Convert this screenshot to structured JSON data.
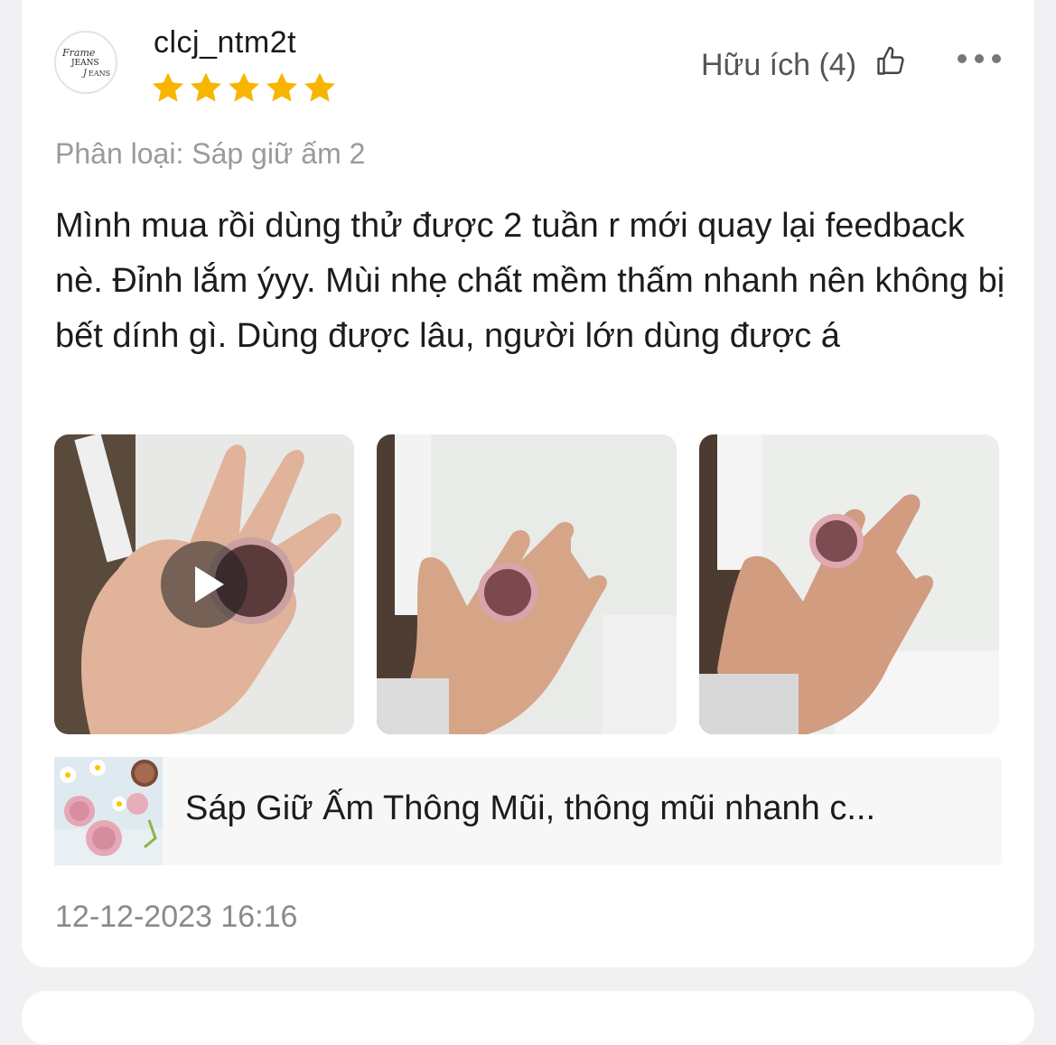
{
  "review": {
    "username": "clcj_ntm2t",
    "rating": 5,
    "rating_max": 5,
    "helpful_label": "Hữu ích (4)",
    "variant": "Phân loại: Sáp giữ ấm 2",
    "text": "Mình mua rồi dùng thử được 2 tuần r mới quay lại feedback nè. Đỉnh lắm ýyy. Mùi nhẹ chất mềm thấm nhanh nên không bị bết dính gì. Dùng được lâu, người lớn dùng được á",
    "media": [
      {
        "type": "video"
      },
      {
        "type": "image"
      },
      {
        "type": "image"
      }
    ],
    "product": {
      "title": "Sáp Giữ Ấm Thông Mũi, thông mũi nhanh c..."
    },
    "timestamp": "12-12-2023 16:16"
  },
  "icons": {
    "star": "star-icon",
    "thumb": "thumbs-up-icon",
    "more": "more-icon",
    "play": "play-icon"
  },
  "colors": {
    "star": "#f7b500",
    "text": "#1c1c1c",
    "muted": "#9a9a9a"
  }
}
